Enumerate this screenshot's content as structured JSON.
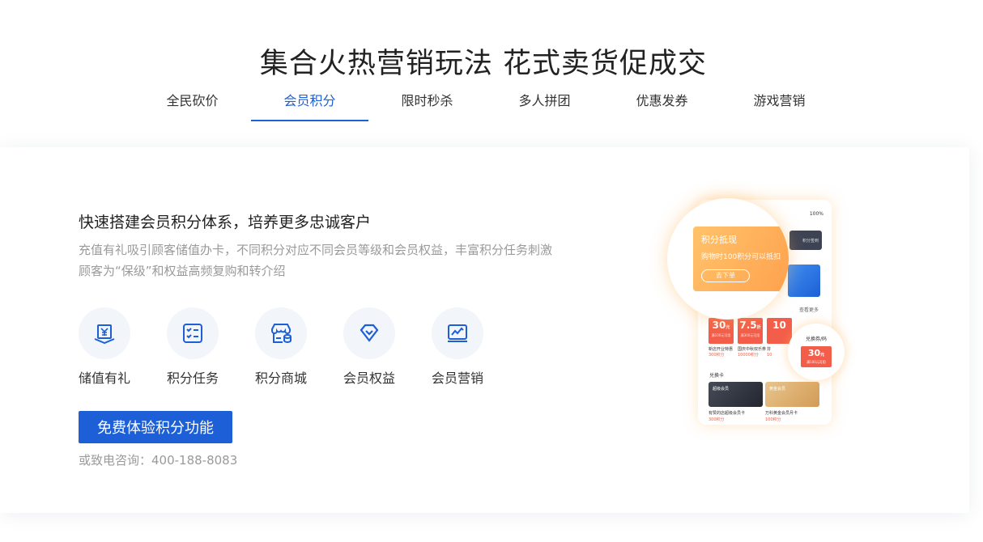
{
  "headline": "集合火热营销玩法 花式卖货促成交",
  "tabs": [
    "全民砍价",
    "会员积分",
    "限时秒杀",
    "多人拼团",
    "优惠发券",
    "游戏营销"
  ],
  "active_tab": 1,
  "panel": {
    "title": "快速搭建会员积分体系，培养更多忠诚客户",
    "description": "充值有礼吸引顾客储值办卡，不同积分对应不同会员等级和会员权益，丰富积分任务刺激顾客为“保级”和权益高频复购和转介绍",
    "features": [
      {
        "label": "储值有礼",
        "icon": "stored-value-icon"
      },
      {
        "label": "积分任务",
        "icon": "task-list-icon"
      },
      {
        "label": "积分商城",
        "icon": "store-icon"
      },
      {
        "label": "会员权益",
        "icon": "diamond-icon"
      },
      {
        "label": "会员营销",
        "icon": "chart-icon"
      }
    ],
    "cta_label": "免费体验积分功能",
    "hotline": "或致电咨询：400-188-8083"
  },
  "phone": {
    "status": "100%",
    "dark_btn": "积分签到",
    "more": "查看更多",
    "coupons": [
      {
        "value": "30",
        "unit": "元",
        "sub": "满100元可用"
      },
      {
        "value": "7.5",
        "unit": "折",
        "sub": "满300元可用"
      },
      {
        "value": "10",
        "unit": "",
        "sub": ""
      }
    ],
    "coupon_names": [
      {
        "name": "新店开业特惠",
        "points": "300积分"
      },
      {
        "name": "国庆中秋双乐券",
        "points": "10000积分"
      },
      {
        "name": "芬",
        "points": "10"
      }
    ],
    "exchange": "兑换卡",
    "cards": [
      {
        "label": "超级会员",
        "name": "有赞的店超级会员卡",
        "points": "300积分"
      },
      {
        "label": "黄金会员",
        "name": "万科黄金会员月卡",
        "points": "100积分"
      }
    ],
    "points_card": {
      "title": "积分抵现",
      "desc": "购物时100积分可以抵扣",
      "button": "去下单"
    },
    "bubble_small": {
      "title": "兑换券/码",
      "value": "30",
      "unit": "元",
      "sub": "满100元可用"
    }
  },
  "colors": {
    "accent": "#1d5fd6",
    "coupon_red": "#f25e4a",
    "orange": "#ffa24e"
  }
}
